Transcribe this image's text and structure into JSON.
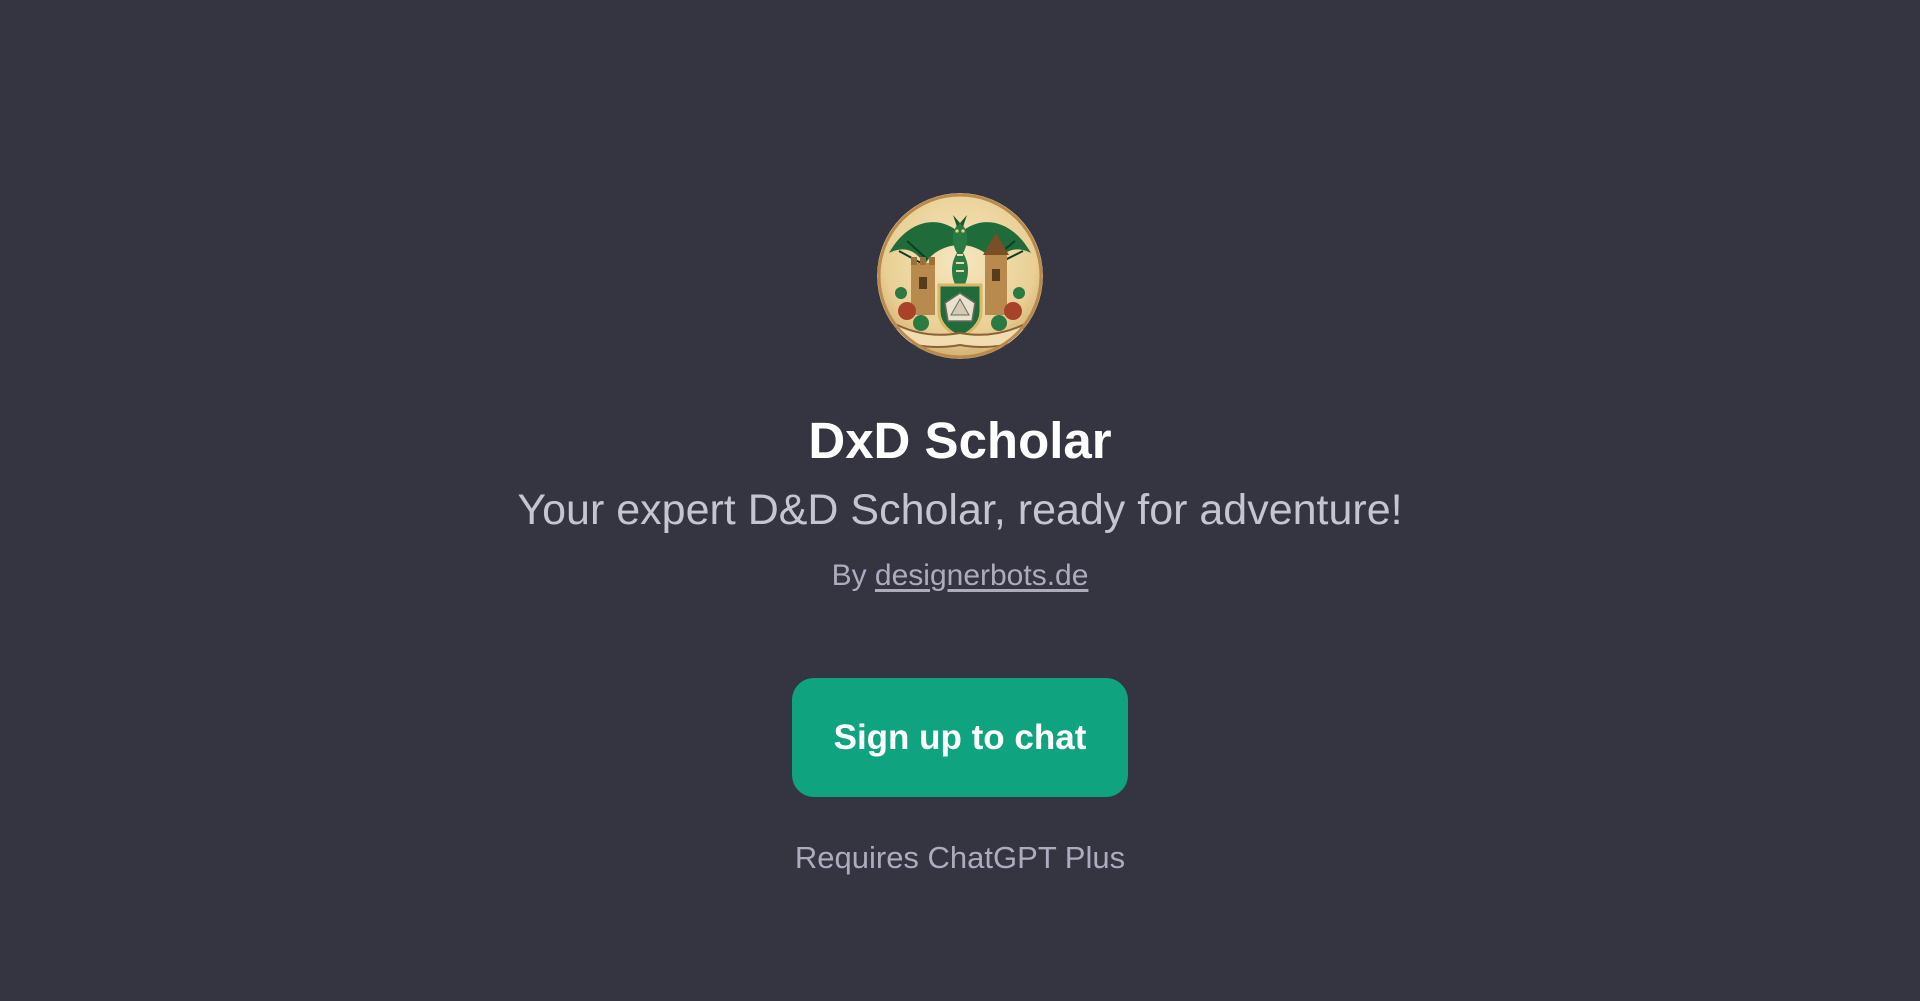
{
  "gpt": {
    "avatar_icon": "dragon-castle-d20-crest-icon",
    "title": "DxD Scholar",
    "description": "Your expert D&D Scholar, ready for adventure!",
    "by_prefix": "By ",
    "author": "designerbots.de"
  },
  "cta": {
    "label": "Sign up to chat"
  },
  "footer": {
    "requirement": "Requires ChatGPT Plus"
  },
  "colors": {
    "background": "#343541",
    "accent": "#10a37f",
    "title_text": "#ffffff",
    "subtitle_text": "#c5c5d2",
    "muted_text": "#acacbe"
  }
}
